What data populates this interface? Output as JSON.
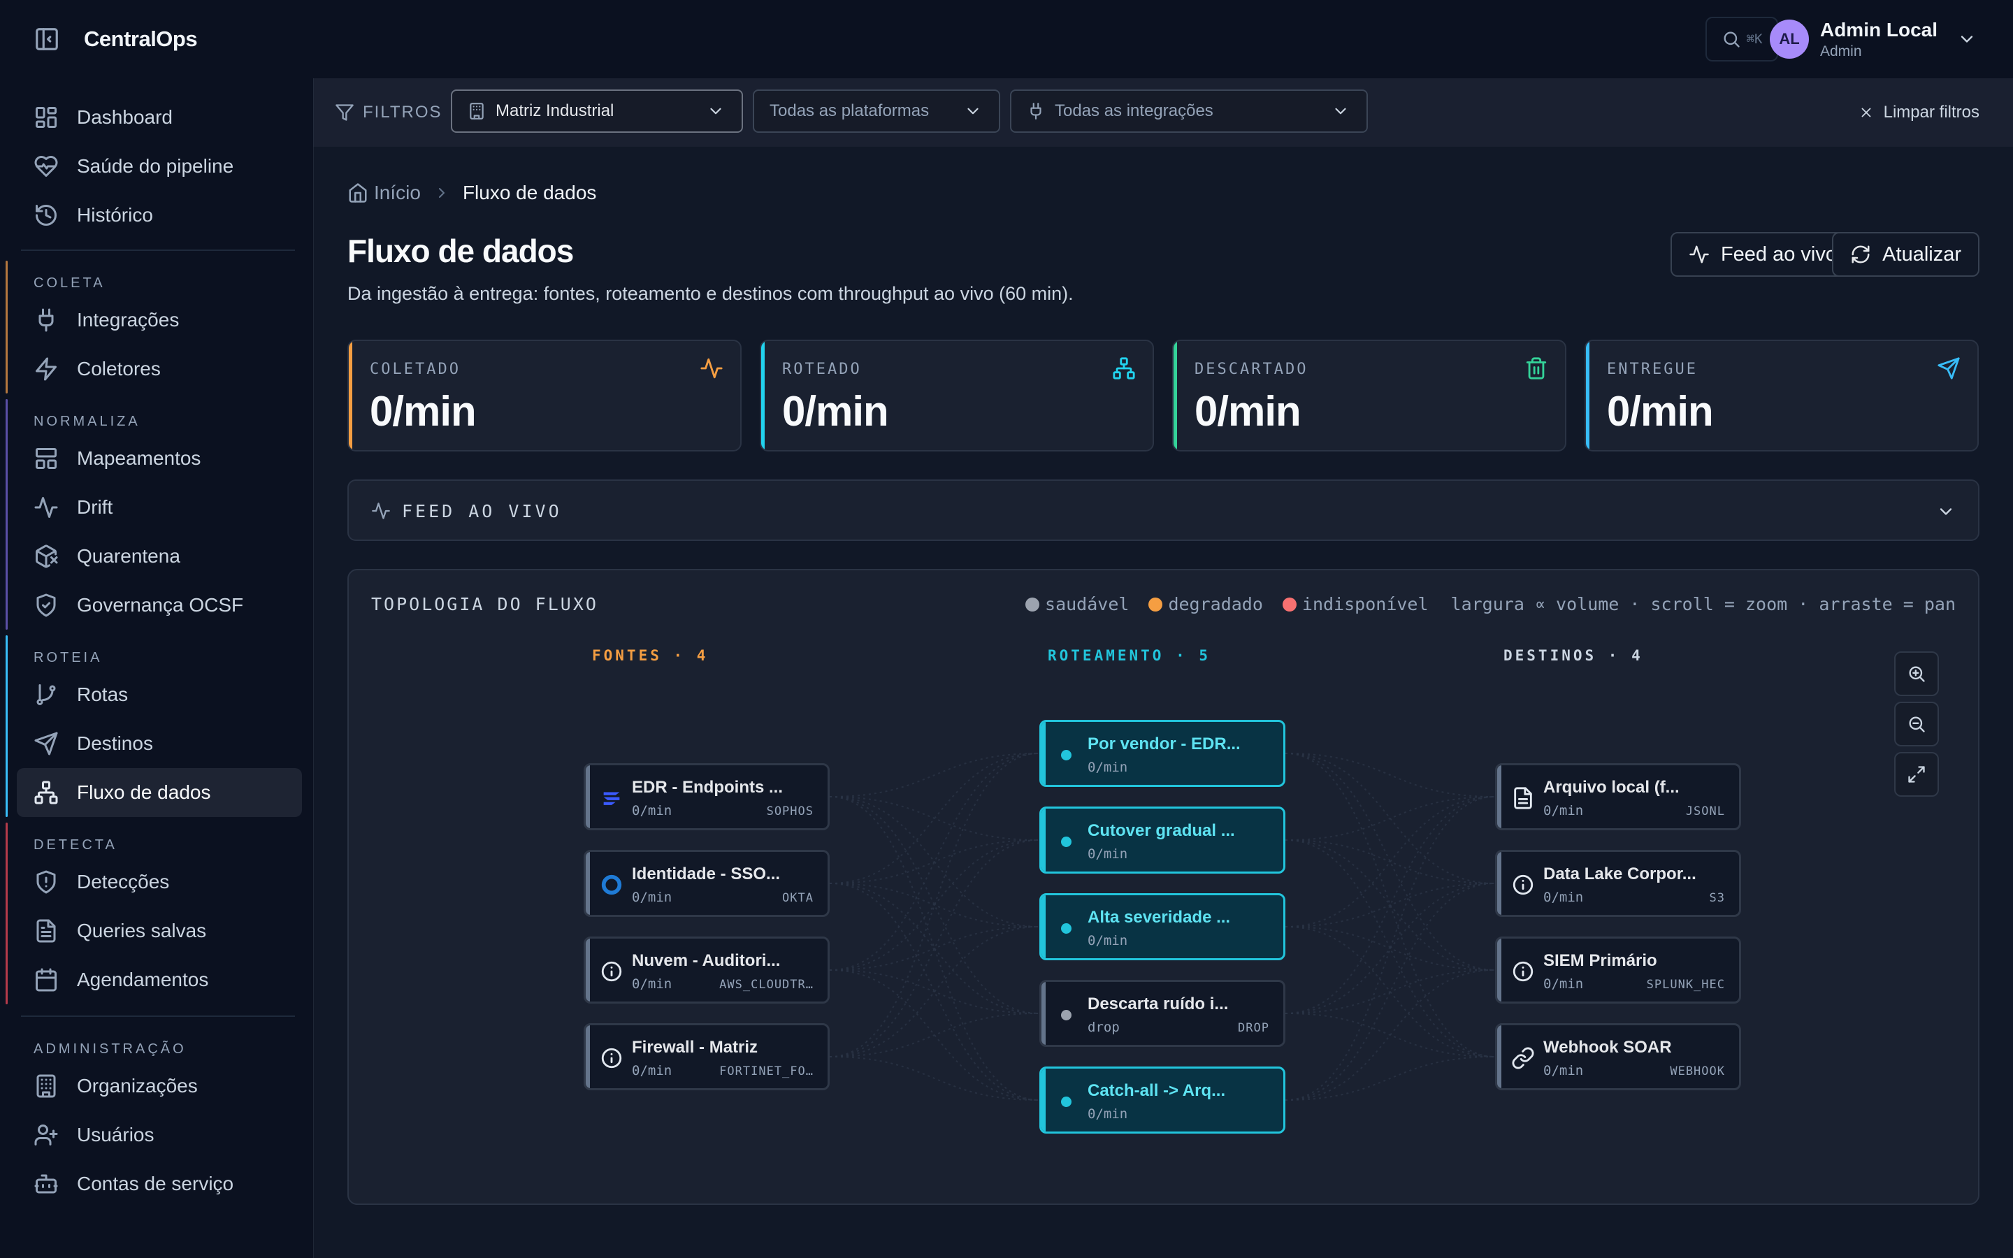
{
  "app": {
    "name": "CentralOps"
  },
  "sidebar": {
    "top": [
      {
        "label": "Dashboard",
        "icon": "dashboard-icon"
      },
      {
        "label": "Saúde do pipeline",
        "icon": "heart-pulse-icon"
      },
      {
        "label": "Histórico",
        "icon": "history-icon"
      }
    ],
    "sections": [
      {
        "title": "COLETA",
        "color": "#b4773f",
        "items": [
          {
            "label": "Integrações",
            "icon": "plug-icon"
          },
          {
            "label": "Coletores",
            "icon": "zap-icon"
          }
        ]
      },
      {
        "title": "NORMALIZA",
        "color": "#5b4fa6",
        "items": [
          {
            "label": "Mapeamentos",
            "icon": "layout-icon"
          },
          {
            "label": "Drift",
            "icon": "activity-icon"
          },
          {
            "label": "Quarentena",
            "icon": "package-x-icon"
          },
          {
            "label": "Governança OCSF",
            "icon": "shield-check-icon"
          }
        ]
      },
      {
        "title": "ROTEIA",
        "color": "#38bdf8",
        "items": [
          {
            "label": "Rotas",
            "icon": "git-branch-icon"
          },
          {
            "label": "Destinos",
            "icon": "send-icon"
          },
          {
            "label": "Fluxo de dados",
            "icon": "network-icon",
            "active": true
          }
        ]
      },
      {
        "title": "DETECTA",
        "color": "#b43a4a",
        "items": [
          {
            "label": "Detecções",
            "icon": "shield-alert-icon"
          },
          {
            "label": "Queries salvas",
            "icon": "file-text-icon"
          },
          {
            "label": "Agendamentos",
            "icon": "calendar-icon"
          }
        ]
      },
      {
        "title": "ADMINISTRAÇÃO",
        "color": "",
        "items": [
          {
            "label": "Organizações",
            "icon": "building-icon"
          },
          {
            "label": "Usuários",
            "icon": "user-plus-icon"
          },
          {
            "label": "Contas de serviço",
            "icon": "bot-icon"
          }
        ]
      }
    ]
  },
  "header": {
    "search_shortcut": "⌘K",
    "user": {
      "initials": "AL",
      "name": "Admin Local",
      "role": "Admin"
    }
  },
  "filters": {
    "label": "FILTROS",
    "org": "Matriz Industrial",
    "platform": "Todas as plataformas",
    "integration": "Todas as integrações",
    "clear": "Limpar filtros"
  },
  "breadcrumb": {
    "home": "Início",
    "current": "Fluxo de dados"
  },
  "page": {
    "title": "Fluxo de dados",
    "subtitle": "Da ingestão à entrega: fontes, roteamento e destinos com throughput ao vivo (60 min).",
    "live_feed_button": "Feed ao vivo",
    "refresh_button": "Atualizar"
  },
  "stats": [
    {
      "label": "COLETADO",
      "value": "0/min",
      "color": "#f59e42",
      "icon": "activity-icon"
    },
    {
      "label": "ROTEADO",
      "value": "0/min",
      "color": "#22d3ee",
      "icon": "network-icon"
    },
    {
      "label": "DESCARTADO",
      "value": "0/min",
      "color": "#34d399",
      "icon": "trash-icon"
    },
    {
      "label": "ENTREGUE",
      "value": "0/min",
      "color": "#38bdf8",
      "icon": "send-icon"
    }
  ],
  "live_feed": {
    "label": "FEED AO VIVO"
  },
  "topology": {
    "title": "TOPOLOGIA DO FLUXO",
    "legend": [
      {
        "label": "saudável",
        "color": "#9ca3af"
      },
      {
        "label": "degradado",
        "color": "#f59e42"
      },
      {
        "label": "indisponível",
        "color": "#f87171"
      }
    ],
    "hint": "largura ∝ volume · scroll = zoom · arraste = pan",
    "columns": {
      "sources": {
        "label": "FONTES · 4",
        "color": "#f59e42"
      },
      "routing": {
        "label": "ROTEAMENTO · 5",
        "color": "#22c5dc"
      },
      "destinations": {
        "label": "DESTINOS · 4",
        "color": "#cbd5e1"
      }
    },
    "sources": [
      {
        "title": "EDR - Endpoints ...",
        "rate": "0/min",
        "kind": "SOPHOS",
        "icon": "sophos-icon"
      },
      {
        "title": "Identidade - SSO...",
        "rate": "0/min",
        "kind": "OKTA",
        "icon": "okta-icon"
      },
      {
        "title": "Nuvem - Auditori...",
        "rate": "0/min",
        "kind": "AWS_CLOUDTR…",
        "icon": "info-icon"
      },
      {
        "title": "Firewall - Matriz",
        "rate": "0/min",
        "kind": "FORTINET_FO…",
        "icon": "info-icon"
      }
    ],
    "routes": [
      {
        "title": "Por vendor - EDR...",
        "rate": "0/min",
        "kind": ""
      },
      {
        "title": "Cutover gradual ...",
        "rate": "0/min",
        "kind": ""
      },
      {
        "title": "Alta severidade ...",
        "rate": "0/min",
        "kind": ""
      },
      {
        "title": "Descarta ruído i...",
        "rate": "drop",
        "kind": "DROP",
        "drop": true
      },
      {
        "title": "Catch-all -> Arq...",
        "rate": "0/min",
        "kind": ""
      }
    ],
    "destinations": [
      {
        "title": "Arquivo local (f...",
        "rate": "0/min",
        "kind": "JSONL",
        "icon": "file-icon"
      },
      {
        "title": "Data Lake Corpor...",
        "rate": "0/min",
        "kind": "S3",
        "icon": "info-icon"
      },
      {
        "title": "SIEM Primário",
        "rate": "0/min",
        "kind": "SPLUNK_HEC",
        "icon": "info-icon"
      },
      {
        "title": "Webhook SOAR",
        "rate": "0/min",
        "kind": "WEBHOOK",
        "icon": "link-icon"
      }
    ]
  }
}
